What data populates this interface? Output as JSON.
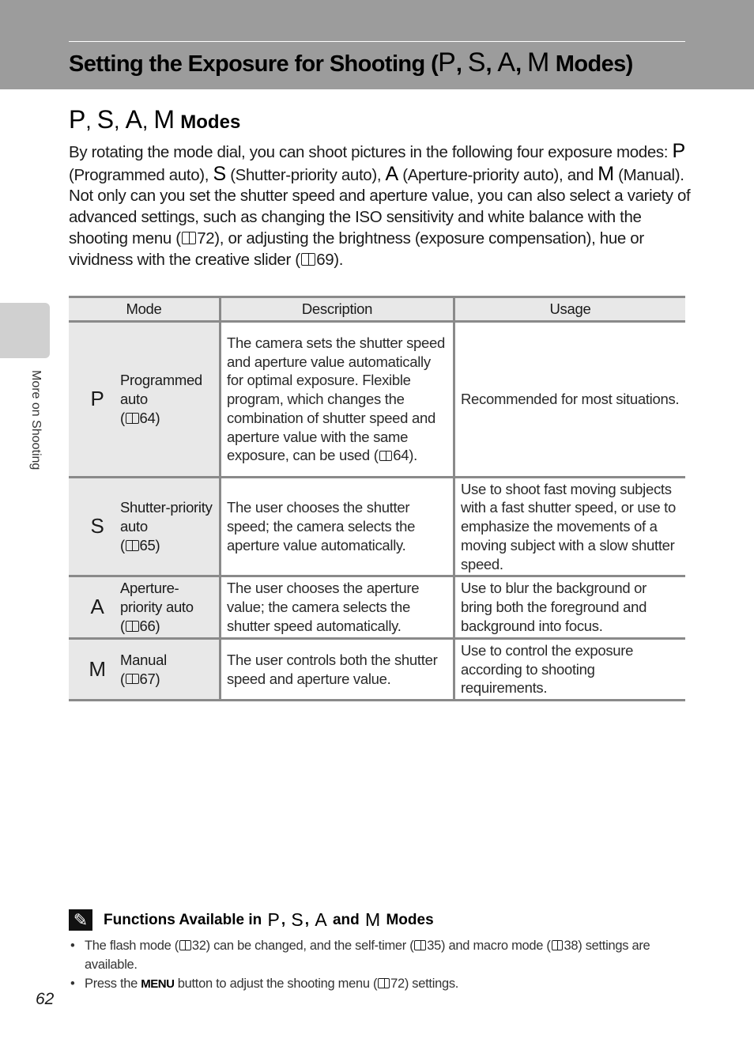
{
  "header": {
    "title_text": "Setting the Exposure for Shooting (",
    "modes": [
      "P",
      "S",
      "A",
      "M"
    ],
    "title_suffix": "Modes)"
  },
  "section": {
    "heading_suffix": "Modes"
  },
  "intro": {
    "p1_a": "By rotating the mode dial, you can shoot pictures in the following four exposure modes:",
    "p1_p": "(Programmed auto),",
    "p1_s": "(Shutter-priority auto),",
    "p1_a2": "(Aperture-priority auto),",
    "p1_and": "and",
    "p1_m": "(Manual).",
    "p2_a": "Not only can you set the shutter speed and aperture value, you can also select a variety of advanced settings, such as changing the ISO sensitivity and white balance with the shooting menu (",
    "p2_ref1": "72), or adjusting the brightness (exposure compensation), hue or vividness with the creative slider (",
    "p2_ref2": "69)."
  },
  "table": {
    "headers": [
      "Mode",
      "Description",
      "Usage"
    ],
    "rows": [
      {
        "glyph": "P",
        "name": "Programmed auto",
        "ref": "64",
        "description_pre": "The camera sets the shutter speed and aperture value automatically for optimal exposure. Flexible program, which changes the combination of shutter speed and aperture value with the same exposure, can be used (",
        "description_ref": "64).",
        "usage": "Recommended for most situations."
      },
      {
        "glyph": "S",
        "name": "Shutter-priority auto",
        "ref": "65",
        "description": "The user chooses the shutter speed; the camera selects the aperture value automatically.",
        "usage": "Use to shoot fast moving subjects with a fast shutter speed, or use to emphasize the movements of a moving subject with a slow shutter speed."
      },
      {
        "glyph": "A",
        "name": "Aperture-priority auto",
        "ref": "66",
        "description": "The user chooses the aperture value; the camera selects the shutter speed automatically.",
        "usage": "Use to blur the background or bring both the foreground and background into focus."
      },
      {
        "glyph": "M",
        "name": "Manual",
        "ref": "67",
        "description": "The user controls both the shutter speed and aperture value.",
        "usage": "Use to control the exposure according to shooting requirements."
      }
    ]
  },
  "side_tab": {
    "label": "More on Shooting"
  },
  "note": {
    "heading_prefix": "Functions Available in",
    "heading_and": "and",
    "heading_suffix": "Modes",
    "icon": "pencil-note-icon",
    "bullet1_a": "The flash mode (",
    "bullet1_b": "32) can be changed, and the self-timer (",
    "bullet1_c": "35) and macro mode (",
    "bullet1_d": "38) settings are available.",
    "bullet2_a": "Press the",
    "bullet2_menu": "MENU",
    "bullet2_b": "button to adjust the shooting menu (",
    "bullet2_c": "72) settings."
  },
  "page_number": "62"
}
